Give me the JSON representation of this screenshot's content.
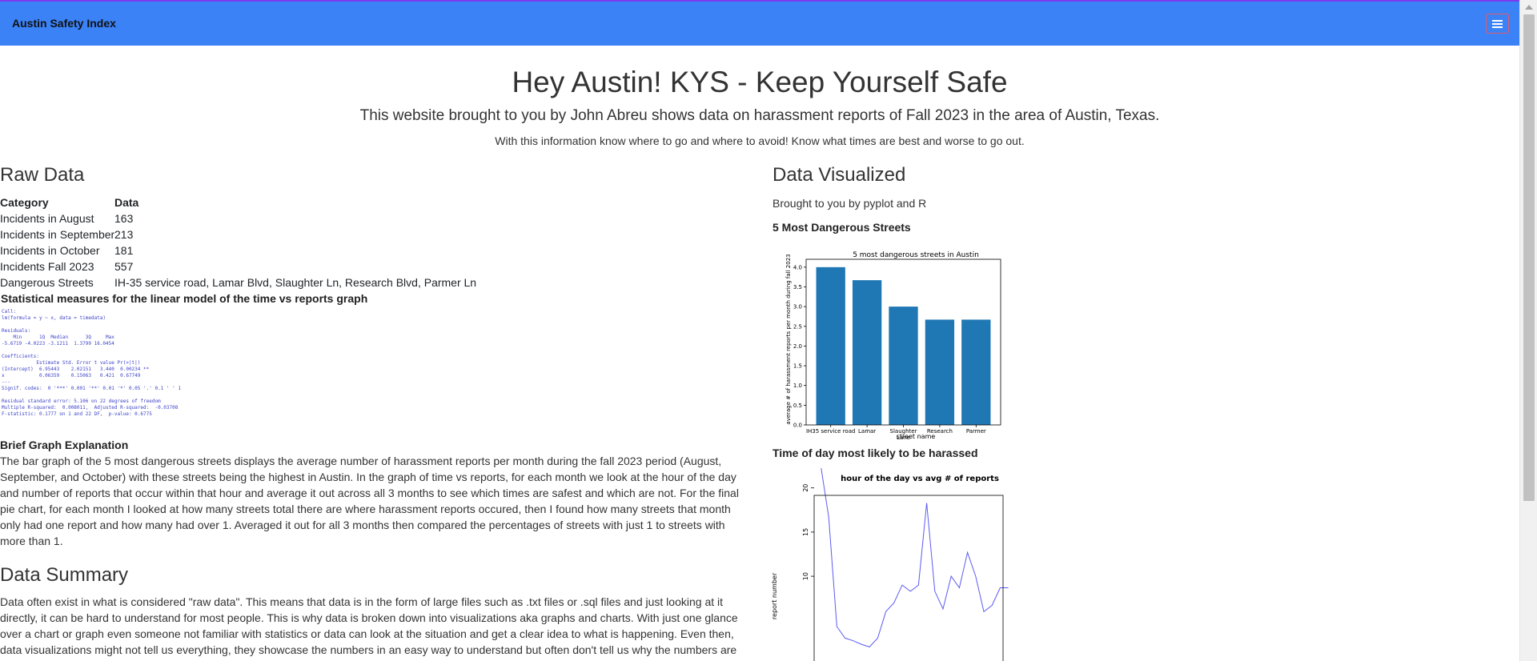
{
  "navbar": {
    "brand": "Austin Safety Index",
    "toggle_icon": "hamburger-menu-icon",
    "bg": "#3b82f6"
  },
  "hero": {
    "title": "Hey Austin! KYS - Keep Yourself Safe",
    "subtitle": "This website brought to you by John Abreu shows data on harassment reports of Fall 2023 in the area of Austin, Texas.",
    "tagline": "With this information know where to go and where to avoid! Know what times are best and worse to go out."
  },
  "raw": {
    "heading": "Raw Data",
    "col_category": "Category",
    "col_data": "Data",
    "rows": [
      {
        "category": "Incidents in August",
        "data": "163"
      },
      {
        "category": "Incidents in September",
        "data": "213"
      },
      {
        "category": "Incidents in October",
        "data": "181"
      },
      {
        "category": "Incidents Fall 2023",
        "data": "557"
      },
      {
        "category": "Dangerous Streets",
        "data": "IH-35 service road, Lamar Blvd, Slaughter Ln, Research Blvd, Parmer Ln"
      }
    ],
    "stats_title": "Statistical measures for the linear model of the time vs reports graph",
    "r_output": "Call:\nlm(formula = y ~ x, data = timedata)\n\nResiduals:\n    Min      1Q  Median      3Q     Max\n-5.6719 -4.0223 -3.1211  1.3799 16.0454\n\nCoefficients:\n            Estimate Std. Error t value Pr(>|t|)\n(Intercept)  6.95443    2.02151   3.440  0.00234 **\nx            0.06359    0.15063   0.421  0.67749\n---\nSignif. codes:  0 '***' 0.001 '**' 0.01 '*' 0.05 '.' 0.1 ' ' 1\n\nResidual standard error: 5.106 on 22 degrees of freedom\nMultiple R-squared:  0.008011,  Adjusted R-squared:  -0.03708\nF-statistic: 0.1777 on 1 and 22 DF,  p-value: 0.6775",
    "brief_title": "Brief Graph Explanation",
    "brief_text": "The bar graph of the 5 most dangerous streets displays the average number of harassment reports per month during the fall 2023 period (August, September, and October) with these streets being the highest in Austin. In the graph of time vs reports, for each month we look at the hour of the day and number of reports that occur within that hour and average it out across all 3 months to see which times are safest and which are not. For the final pie chart, for each month I looked at how many streets total there are where harassment reports occured, then I found how many streets that month only had one report and how many had over 1. Averaged it out for all 3 months then compared the percentages of streets with just 1 to streets with more than 1."
  },
  "summary": {
    "heading": "Data Summary",
    "text": "Data often exist in what is considered \"raw data\". This means that data is in the form of large files such as .txt files or .sql files and just looking at it directly, it can be hard to understand for most people. This is why data is broken down into visualizations aka graphs and charts. With just one glance over a chart or graph even someone not familiar with statistics or data can look at the situation and get a clear idea to what is happening. Even then, data visualizations might not tell us everything, they showcase the numbers in an easy way to understand but often don't tell us why the numbers are"
  },
  "viz": {
    "heading": "Data Visualized",
    "credit": "Brought to you by pyplot and R",
    "bar_heading": "5 Most Dangerous Streets",
    "line_heading": "Time of day most likely to be harassed"
  },
  "chart_data": [
    {
      "type": "bar",
      "title": "5 most dangerous streets in Austin",
      "xlabel": "street name",
      "ylabel": "average # of harassment reports per month during fall 2023",
      "categories": [
        "IH35 service road",
        "Lamar",
        "Slaughter Lane",
        "Research",
        "Parmer"
      ],
      "values": [
        4.0,
        3.67,
        3.0,
        2.67,
        2.67
      ],
      "ylim": [
        0,
        4.2
      ],
      "yticks": [
        "0.0",
        "0.5",
        "1.0",
        "1.5",
        "2.0",
        "2.5",
        "3.0",
        "3.5",
        "4.0"
      ],
      "color": "#1f77b4",
      "grid": false
    },
    {
      "type": "line",
      "title": "hour of the day vs avg # of reports",
      "ylabel": "report number",
      "x": [
        0,
        1,
        2,
        3,
        4,
        5,
        6,
        7,
        8,
        9,
        10,
        11,
        12,
        13,
        14,
        15,
        16,
        17,
        18,
        19,
        20,
        21,
        22,
        23
      ],
      "y": [
        22.7,
        16.7,
        4.3,
        3.0,
        2.7,
        2.3,
        2.0,
        3.0,
        6.0,
        7.0,
        9.0,
        8.3,
        9.0,
        18.3,
        8.3,
        6.3,
        10.0,
        8.7,
        12.7,
        10.0,
        6.0,
        6.7,
        8.7,
        8.7
      ],
      "yticks": [
        "10",
        "15",
        "20"
      ],
      "color": "#5b5bf0",
      "grid": false
    }
  ]
}
